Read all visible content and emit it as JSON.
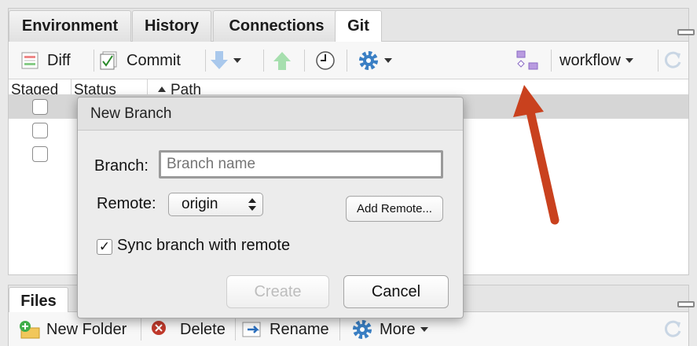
{
  "top_pane": {
    "tabs": [
      {
        "label": "Environment",
        "active": false
      },
      {
        "label": "History",
        "active": false
      },
      {
        "label": "Connections",
        "active": false
      },
      {
        "label": "Git",
        "active": true
      }
    ],
    "toolbar": {
      "diff_label": "Diff",
      "commit_label": "Commit",
      "branch_label": "workflow"
    },
    "columns": {
      "staged": "Staged",
      "status": "Status",
      "path": "Path"
    }
  },
  "dialog": {
    "title": "New Branch",
    "branch_label": "Branch:",
    "branch_placeholder": "Branch name",
    "remote_label": "Remote:",
    "remote_value": "origin",
    "add_remote_label": "Add Remote...",
    "sync_label": "Sync branch with remote",
    "sync_checked": true,
    "create_label": "Create",
    "cancel_label": "Cancel"
  },
  "bottom_pane": {
    "tabs": [
      {
        "label": "Files",
        "active": true
      }
    ],
    "toolbar": {
      "new_folder_label": "New Folder",
      "delete_label": "Delete",
      "rename_label": "Rename",
      "more_label": "More"
    }
  },
  "colors": {
    "annotation_arrow": "#c9411e",
    "pull_arrow": "#a9c8ec",
    "push_arrow": "#a6dfae",
    "gear": "#3a7fc4"
  }
}
